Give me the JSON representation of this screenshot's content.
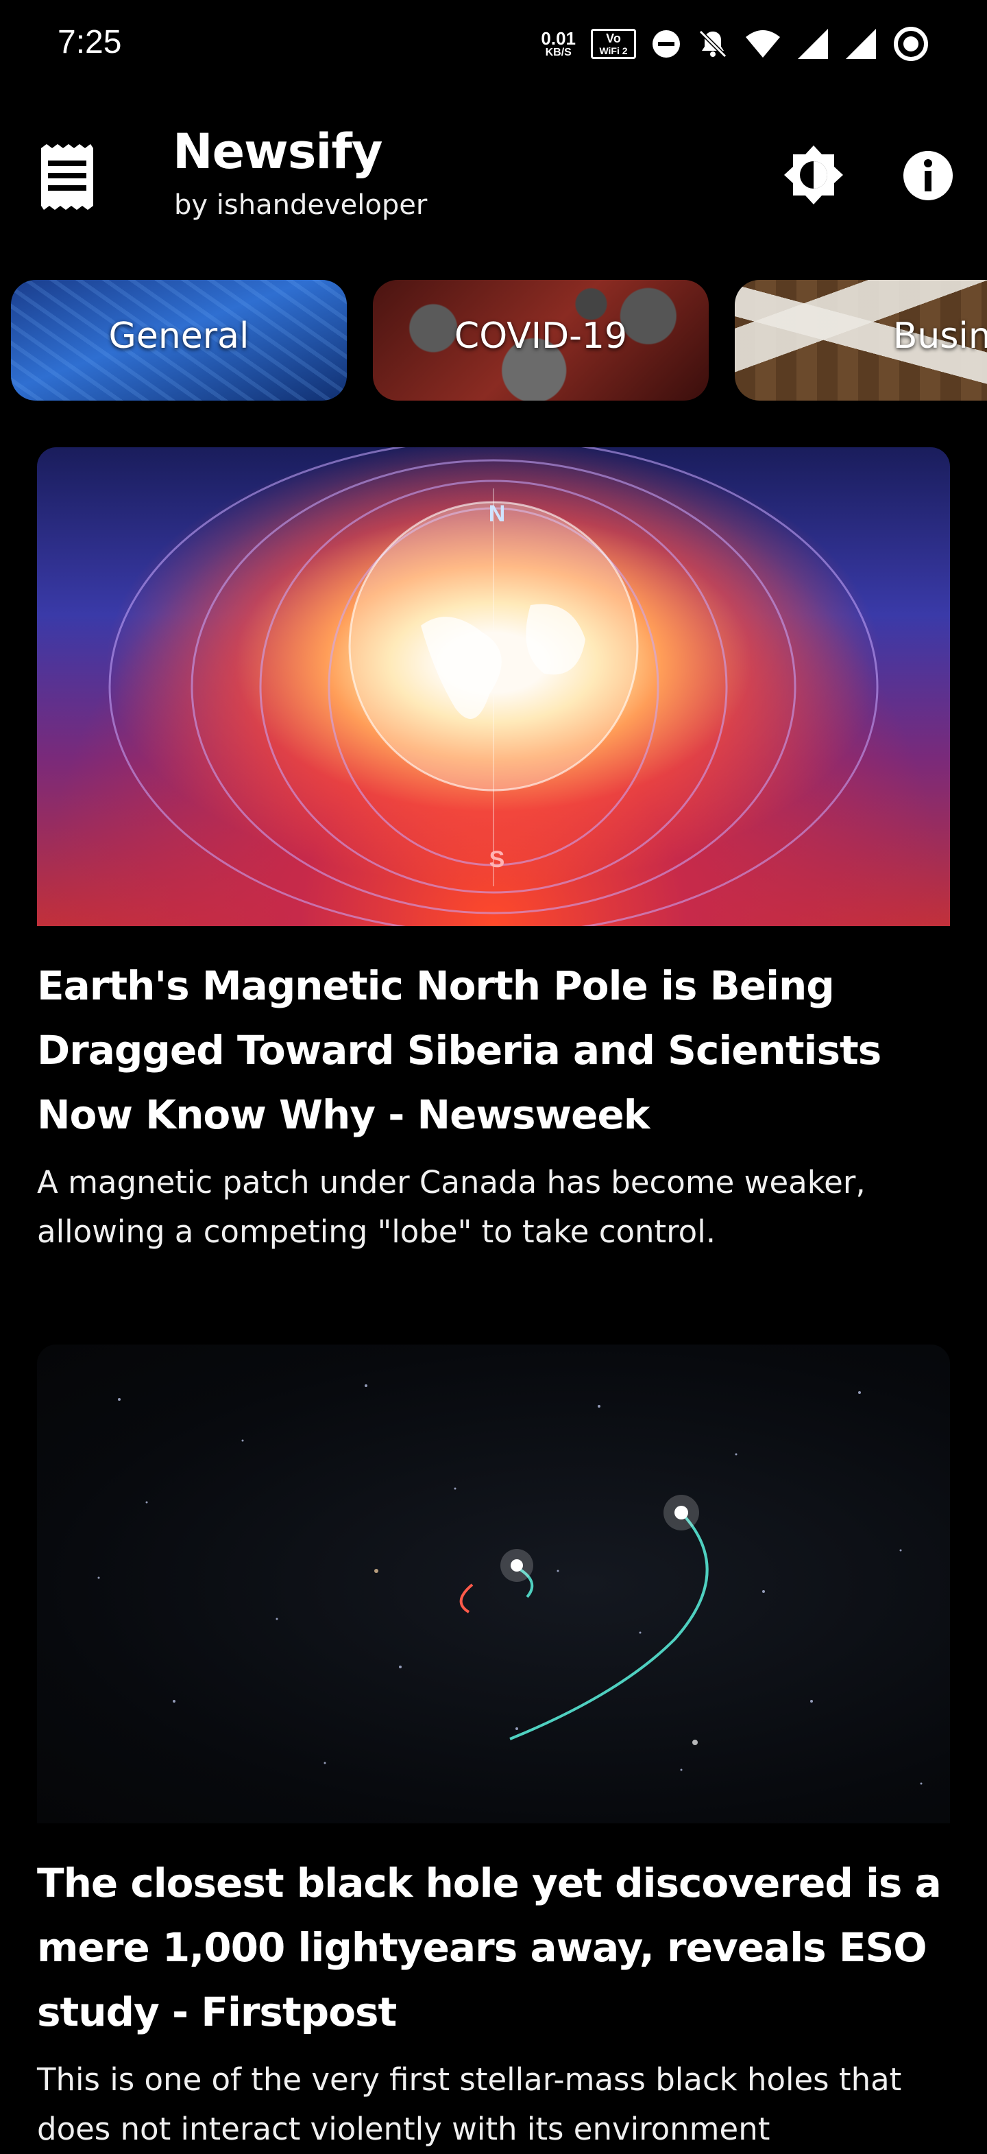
{
  "status_bar": {
    "time": "7:25",
    "net_speed_value": "0.01",
    "net_speed_unit": "KB/S",
    "vowifi_label_line1": "Vo",
    "vowifi_label_line2": "WiFi 2",
    "icons": [
      "data-saver-icon",
      "notifications-off-icon",
      "wifi-icon",
      "signal-icon",
      "signal-icon",
      "sync-icon"
    ]
  },
  "app_bar": {
    "title": "Newsify",
    "subtitle": "by ishandeveloper",
    "icons": [
      "menu-icon",
      "brightness-icon",
      "info-icon"
    ]
  },
  "categories": [
    {
      "label": "General"
    },
    {
      "label": "COVID-19"
    },
    {
      "label": "Business"
    }
  ],
  "articles": [
    {
      "title": "Earth's Magnetic North Pole is Being Dragged Toward Siberia and Scientists Now Know Why - Newsweek",
      "description": "A magnetic patch under Canada has become weaker, allowing a competing \"lobe\" to take control.",
      "image_labels": {
        "north": "N",
        "south": "S"
      }
    },
    {
      "title": "The closest black hole yet discovered is a mere 1,000 lightyears away, reveals ESO study - Firstpost",
      "description": "This is one of the very first stellar-mass black holes that does not interact violently with its environment"
    }
  ]
}
